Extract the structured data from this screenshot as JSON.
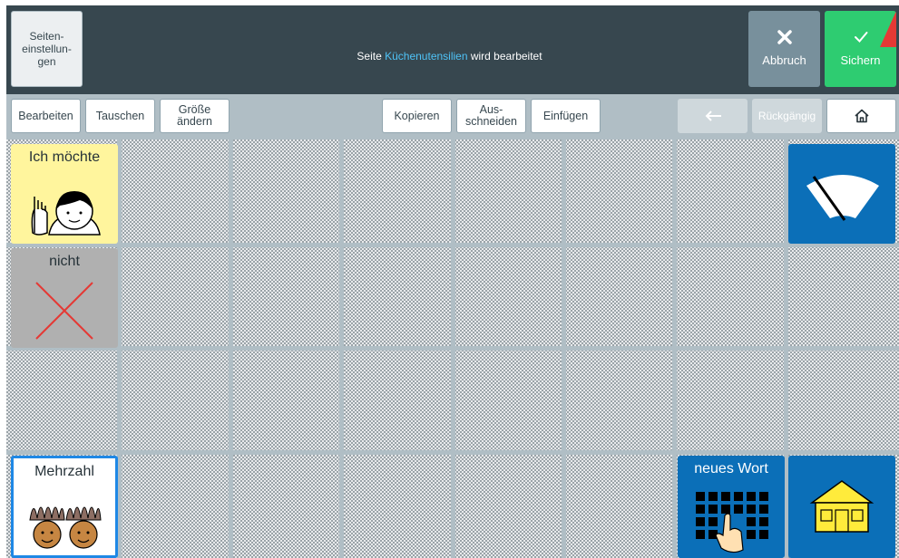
{
  "header": {
    "settings_label": "Seiten-\neinstellun-\ngen",
    "status_prefix": "Seite ",
    "status_page": "Küchenutensilien",
    "status_suffix": " wird bearbeitet",
    "cancel_label": "Abbruch",
    "save_label": "Sichern"
  },
  "toolbar": {
    "edit": "Bearbeiten",
    "swap": "Tauschen",
    "resize": "Größe\nändern",
    "copy": "Kopieren",
    "cut": "Aus-\nschneiden",
    "paste": "Einfügen",
    "undo": "Rückgängig"
  },
  "tiles": {
    "want": "Ich möchte",
    "not": "nicht",
    "plural": "Mehrzahl",
    "new_word": "neues Wort"
  },
  "colors": {
    "header_bg": "#37474f",
    "save": "#2ecc71",
    "cancel": "#78909c",
    "tile_blue": "#0b6fb8",
    "tile_yellow": "#fff59d"
  }
}
